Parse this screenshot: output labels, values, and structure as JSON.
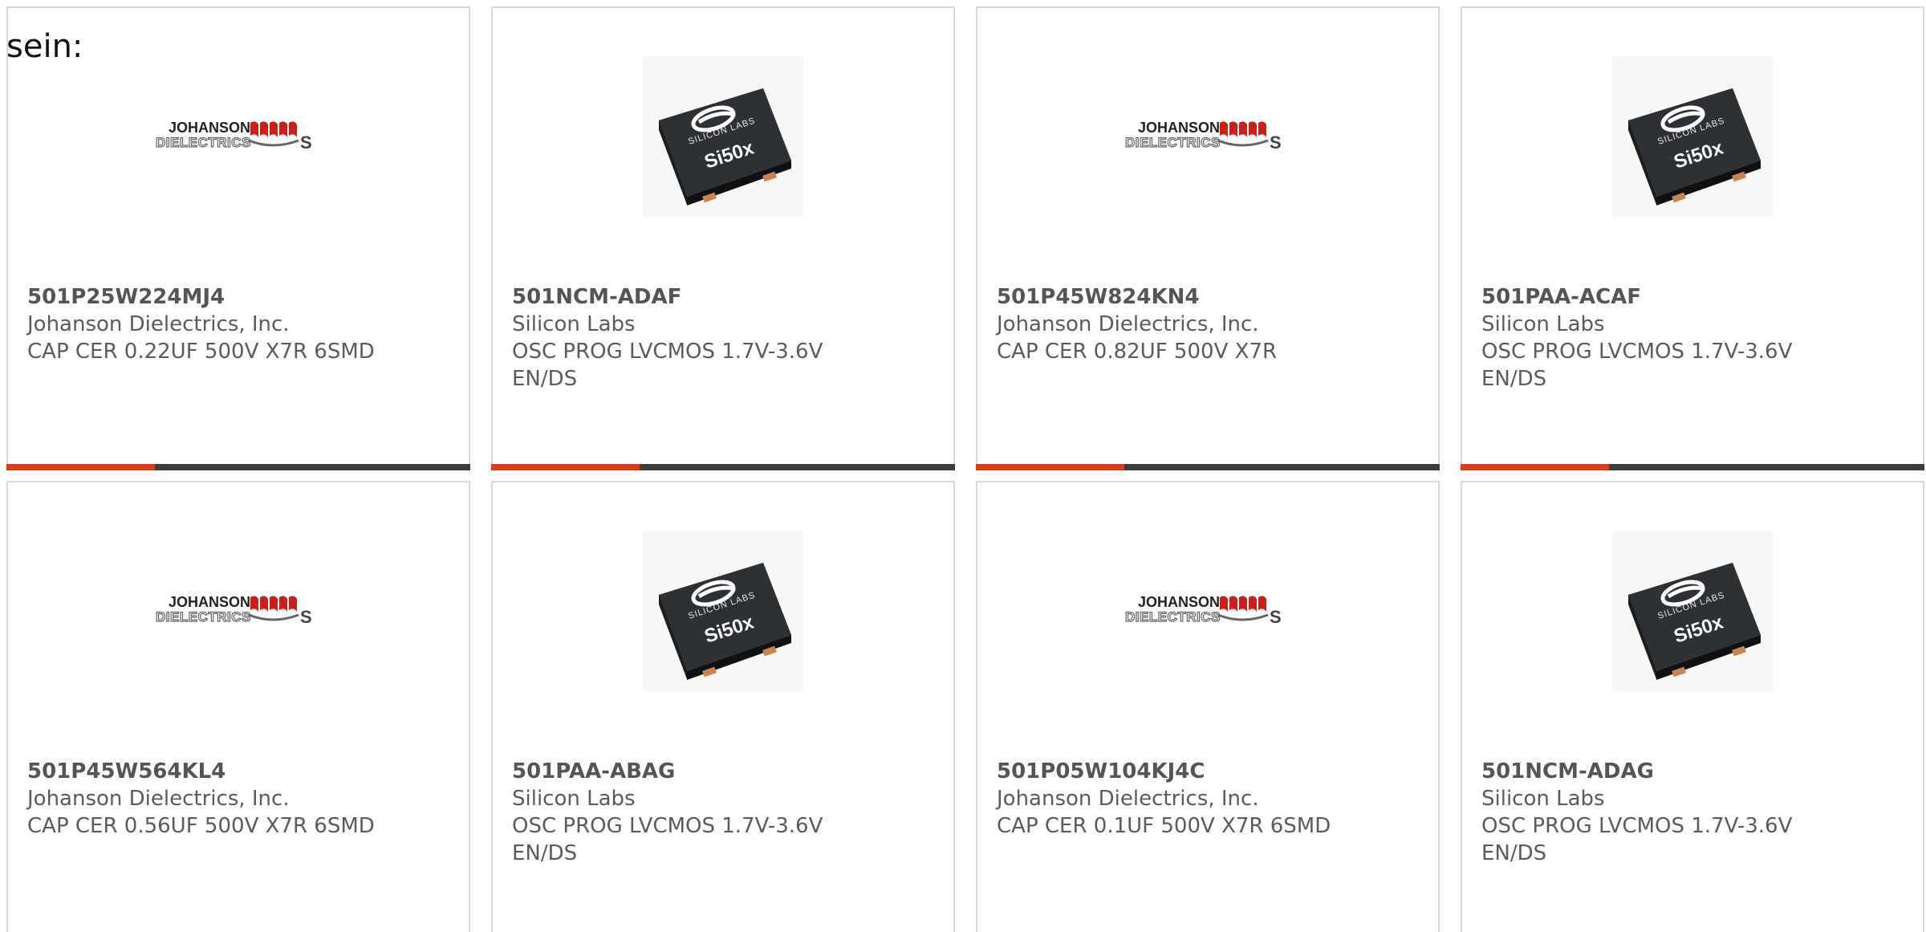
{
  "intro_text": "sein:",
  "colors": {
    "accent": "#e03a12",
    "bar": "#3d3d3d",
    "border": "#d9d9d9",
    "text": "#5b5b5b"
  },
  "products": [
    {
      "part": "501P25W224MJ4",
      "manufacturer": "Johanson Dielectrics, Inc.",
      "desc_lines": [
        "CAP CER 0.22UF 500V X7R 6SMD"
      ],
      "image": "johanson-logo",
      "progress": 0.32
    },
    {
      "part": "501NCM-ADAF",
      "manufacturer": "Silicon Labs",
      "desc_lines": [
        "OSC PROG LVCMOS 1.7V-3.6V",
        "EN/DS"
      ],
      "image": "si50x-chip",
      "progress": 0.32
    },
    {
      "part": "501P45W824KN4",
      "manufacturer": "Johanson Dielectrics, Inc.",
      "desc_lines": [
        "CAP CER 0.82UF 500V X7R"
      ],
      "image": "johanson-logo",
      "progress": 0.32
    },
    {
      "part": "501PAA-ACAF",
      "manufacturer": "Silicon Labs",
      "desc_lines": [
        "OSC PROG LVCMOS 1.7V-3.6V",
        "EN/DS"
      ],
      "image": "si50x-chip",
      "progress": 0.32
    },
    {
      "part": "501P45W564KL4",
      "manufacturer": "Johanson Dielectrics, Inc.",
      "desc_lines": [
        "CAP CER 0.56UF 500V X7R 6SMD"
      ],
      "image": "johanson-logo",
      "progress": 0.32
    },
    {
      "part": "501PAA-ABAG",
      "manufacturer": "Silicon Labs",
      "desc_lines": [
        "OSC PROG LVCMOS 1.7V-3.6V",
        "EN/DS"
      ],
      "image": "si50x-chip",
      "progress": 0.32
    },
    {
      "part": "501P05W104KJ4C",
      "manufacturer": "Johanson Dielectrics, Inc.",
      "desc_lines": [
        "CAP CER 0.1UF 500V X7R 6SMD"
      ],
      "image": "johanson-logo",
      "progress": 0.32
    },
    {
      "part": "501NCM-ADAG",
      "manufacturer": "Silicon Labs",
      "desc_lines": [
        "OSC PROG LVCMOS 1.7V-3.6V",
        "EN/DS"
      ],
      "image": "si50x-chip",
      "progress": 0.32
    }
  ],
  "logos": {
    "johanson": {
      "line1": "JOHANSON",
      "line2": "DIELECTRICS"
    },
    "chip": {
      "line1": "SILICON LABS",
      "line2": "Si50x"
    }
  }
}
